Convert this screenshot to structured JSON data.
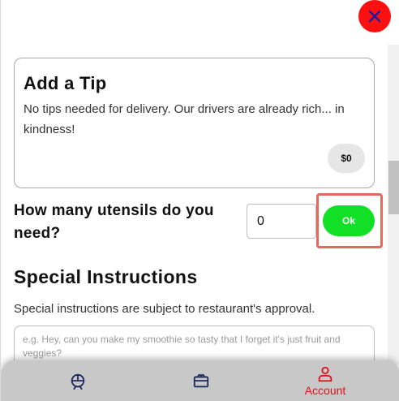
{
  "close": {
    "icon": "close-x-icon",
    "color": "#ff1010"
  },
  "tip": {
    "title": "Add a Tip",
    "description": "No tips needed for delivery. Our drivers are already rich... in kindness!",
    "amount": "$0"
  },
  "utensils": {
    "label": "How many utensils do you need?",
    "value": "0",
    "ok_label": "Ok",
    "ok_color": "#11e026"
  },
  "special": {
    "title": "Special Instructions",
    "note": "Special instructions are subject to restaurant's approval.",
    "placeholder": "e.g. Hey, can you make my smoothie so tasty that I forget it's just fruit and veggies?"
  },
  "nav": {
    "items": [
      {
        "icon": "food-dome-icon"
      },
      {
        "icon": "gift-card-icon"
      },
      {
        "icon": "user-icon",
        "label": "Account",
        "active_color": "#e0101a"
      }
    ]
  }
}
